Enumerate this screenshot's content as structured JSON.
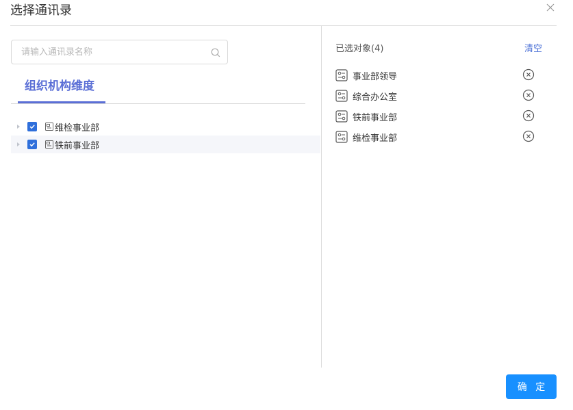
{
  "dialog": {
    "title": "选择通讯录"
  },
  "search": {
    "placeholder": "请输入通讯录名称",
    "value": ""
  },
  "tabs": [
    {
      "label": "组织机构维度",
      "active": true
    }
  ],
  "tree": [
    {
      "label": "维检事业部",
      "checked": true,
      "highlighted": false
    },
    {
      "label": "铁前事业部",
      "checked": true,
      "highlighted": true
    }
  ],
  "selected": {
    "title": "已选对象(4)",
    "clear_label": "清空",
    "items": [
      {
        "label": "事业部领导"
      },
      {
        "label": "综合办公室"
      },
      {
        "label": "铁前事业部"
      },
      {
        "label": "维检事业部"
      }
    ]
  },
  "footer": {
    "confirm_label": "确 定"
  },
  "colors": {
    "accent": "#5b6fd6",
    "checkbox": "#2f6fdb",
    "button": "#1890ff"
  }
}
